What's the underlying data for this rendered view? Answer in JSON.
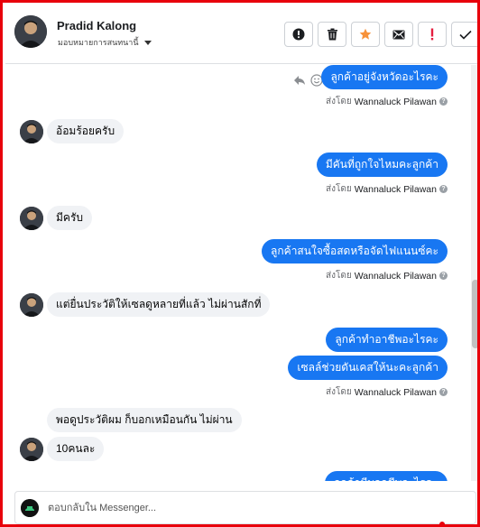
{
  "header": {
    "contact_name": "Pradid Kalong",
    "assign_label": "มอบหมายการสนทนานี้",
    "actions": [
      {
        "name": "spam-button",
        "icon": "exclamation-circle-icon"
      },
      {
        "name": "delete-button",
        "icon": "trash-icon"
      },
      {
        "name": "star-button",
        "icon": "star-icon",
        "color": "#f7923a"
      },
      {
        "name": "mark-unread-button",
        "icon": "envelope-icon"
      },
      {
        "name": "follow-up-button",
        "icon": "exclamation-icon",
        "color": "#e41e3f"
      },
      {
        "name": "done-button",
        "icon": "check-icon"
      }
    ]
  },
  "thread": {
    "sent_by_prefix": "ส่งโดย",
    "agent_name": "Wannaluck Pilawan",
    "messages": [
      {
        "dir": "out",
        "text": "ลูกค้าอยู่จังหวัดอะไรคะ"
      },
      {
        "dir": "in",
        "text": "อ้อมร้อยครับ"
      },
      {
        "dir": "out",
        "text": "มีคันที่ถูกใจไหมคะลูกค้า"
      },
      {
        "dir": "in",
        "text": "มีครับ"
      },
      {
        "dir": "out",
        "text": "ลูกค้าสนใจซื้อสดหรือจัดไฟแนนซ์คะ"
      },
      {
        "dir": "in",
        "text": "แต่ยื่นประวัติให้เซลดูหลายที่แล้ว ไม่ผ่านสักที่"
      },
      {
        "dir": "out",
        "text": "ลูกค้าทำอาชีพอะไรคะ"
      },
      {
        "dir": "out",
        "text": "เซลล์ช่วยดันเคสให้นะคะลูกค้า"
      },
      {
        "dir": "in",
        "text": "พอดูประวัติผม ก็บอกเหมือนกัน ไม่ผ่าน"
      },
      {
        "dir": "in",
        "text": "10คนละ"
      },
      {
        "dir": "out",
        "text": "ลูกค้ามีบอกชีพอะไรคะ"
      }
    ]
  },
  "composer": {
    "placeholder": "ตอบกลับใน Messenger..."
  },
  "colors": {
    "outgoing": "#1877f2",
    "incoming": "#f0f2f5",
    "frame": "#e8000b"
  }
}
